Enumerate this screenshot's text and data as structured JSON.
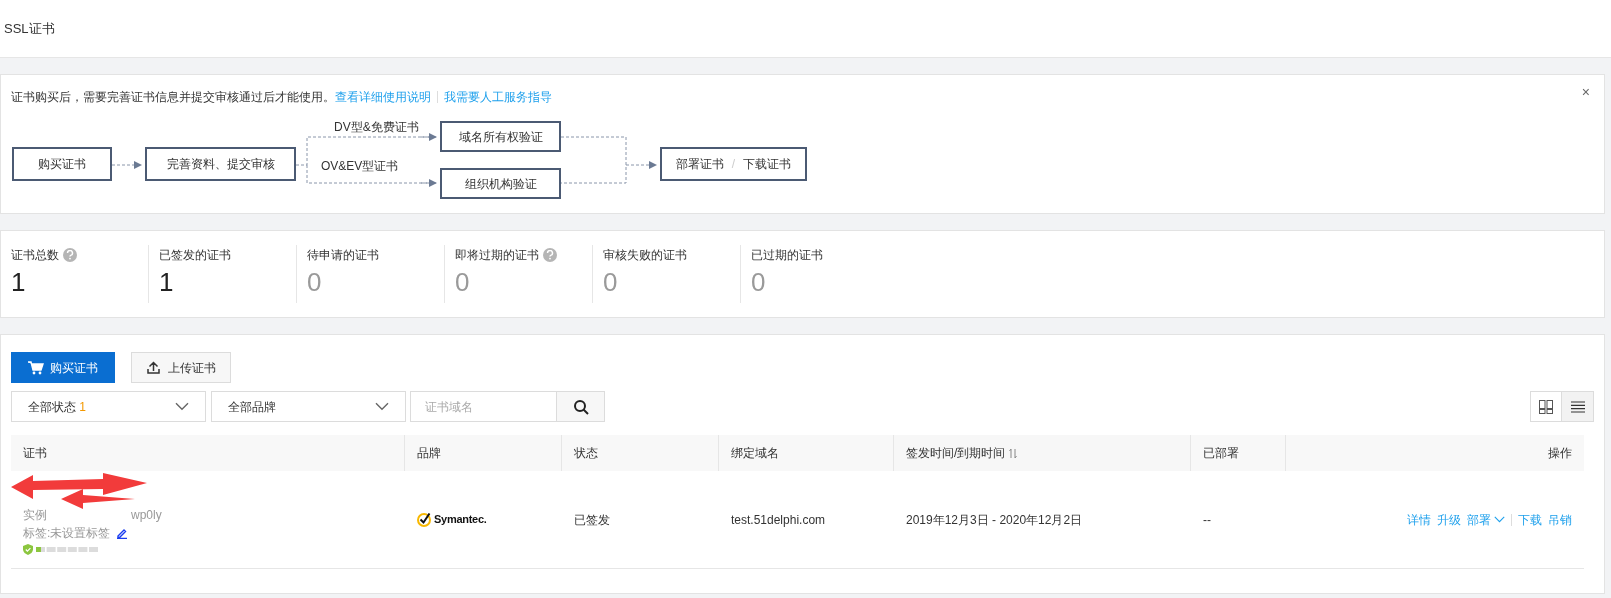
{
  "header": {
    "title": "SSL证书"
  },
  "notice": {
    "text": "证书购买后，需要完善证书信息并提交审核通过后才能使用。",
    "links": [
      "查看详细使用说明",
      "我需要人工服务指导"
    ],
    "close": "×"
  },
  "flow": {
    "steps": [
      "购买证书",
      "完善资料、提交审核"
    ],
    "branches": [
      {
        "label": "DV型&免费证书",
        "step": "域名所有权验证"
      },
      {
        "label": "OV&EV型证书",
        "step": "组织机构验证"
      }
    ],
    "final": [
      "部署证书",
      "下载证书"
    ],
    "final_sep": "/"
  },
  "stats": [
    {
      "label": "证书总数",
      "help": true,
      "value": "1",
      "dimmed": false
    },
    {
      "label": "已签发的证书",
      "help": false,
      "value": "1",
      "dimmed": false
    },
    {
      "label": "待申请的证书",
      "help": false,
      "value": "0",
      "dimmed": true
    },
    {
      "label": "即将过期的证书",
      "help": true,
      "value": "0",
      "dimmed": true
    },
    {
      "label": "审核失败的证书",
      "help": false,
      "value": "0",
      "dimmed": true
    },
    {
      "label": "已过期的证书",
      "help": false,
      "value": "0",
      "dimmed": true
    }
  ],
  "toolbar": {
    "buy": "购买证书",
    "upload": "上传证书"
  },
  "filters": {
    "status": {
      "label": "全部状态",
      "count": "1"
    },
    "brand": {
      "label": "全部品牌"
    },
    "search": {
      "placeholder": "证书域名"
    }
  },
  "views": [
    {
      "kind": "grid",
      "selected": false
    },
    {
      "kind": "list",
      "selected": true
    }
  ],
  "table": {
    "columns": [
      {
        "label": "证书",
        "sortable": false
      },
      {
        "label": "品牌",
        "sortable": false
      },
      {
        "label": "状态",
        "sortable": false
      },
      {
        "label": "绑定域名",
        "sortable": false
      },
      {
        "label": "签发时间/到期时间",
        "sortable": true
      },
      {
        "label": "已部署",
        "sortable": false
      },
      {
        "label": "操作",
        "sortable": false
      }
    ],
    "rows": [
      {
        "instance_prefix": "实例",
        "instance_tail": "wp0ly",
        "tag": "标签:未设置标签",
        "level": 0.08,
        "brand": "Symantec.",
        "status": "已签发",
        "domain": "test.51delphi.com",
        "period": "2019年12月3日 - 2020年12月2日",
        "deployed": "--",
        "actions": [
          {
            "label": "详情",
            "kind": "link"
          },
          {
            "label": "升级",
            "kind": "link"
          },
          {
            "label": "部署",
            "kind": "menu"
          },
          {
            "label": "下载",
            "kind": "link"
          },
          {
            "label": "吊销",
            "kind": "link"
          }
        ]
      }
    ]
  }
}
